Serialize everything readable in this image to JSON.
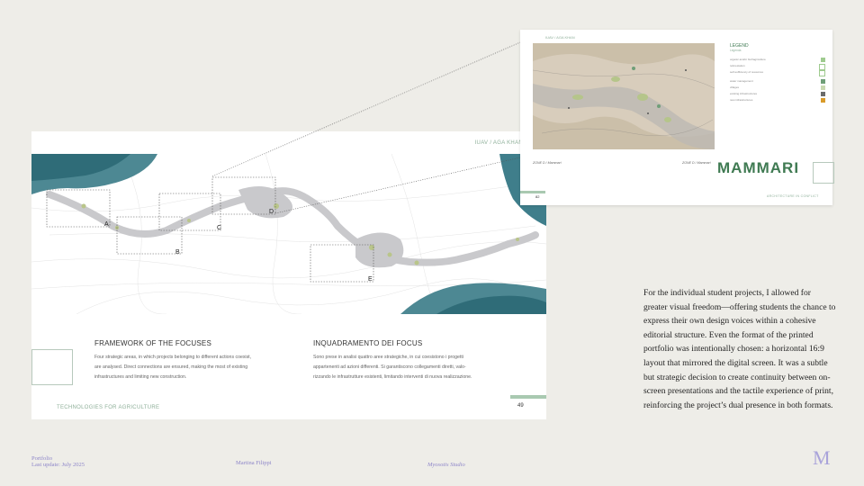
{
  "main_page": {
    "header": "IUAV / AGA KHAN",
    "map_labels": [
      "A",
      "B",
      "C",
      "D",
      "E"
    ],
    "left_section": {
      "title": "FRAMEWORK OF THE FOCUSES",
      "lines": [
        "Four strategic areas, in which projects belonging to different actions coexist,",
        "are analysed. Direct connections are ensured, making the most of existing",
        "infrastructures and limiting new construction."
      ]
    },
    "right_section": {
      "title": "INQUADRAMENTO DEI FOCUS",
      "lines": [
        "Sono prese in analisi quattro aree strategiche, in cui coesistono i progetti",
        "appartenenti ad azioni differenti. Si garantiscono collegamenti diretti, valo-",
        "rizzando le infrastrutture esistenti, limitando interventi di nuova realizzazione."
      ]
    },
    "footer": "TECHNOLOGIES FOR AGRICULTURE",
    "page_number": "49"
  },
  "inset_page": {
    "header": "IUAV / AGA KHAN",
    "legend_title": "LEGEND",
    "legend_subtitle": "Legenda",
    "legend_items": [
      {
        "label": "organic and/or biofragriculture",
        "color": "#9fcb8f"
      },
      {
        "label": "reforestation",
        "color": "#ffffff"
      },
      {
        "label": "self-sufficiency of resources",
        "color": "#ffffff"
      },
      {
        "label": "water management",
        "color": "#6f9e78"
      },
      {
        "label": "villages",
        "color": "#c8d8b0"
      },
      {
        "label": "existing infrastructures",
        "color": "#6b6b6b"
      },
      {
        "label": "new infrastructures",
        "color": "#d99b2a"
      }
    ],
    "zone_left": "ZONE D / Mammari",
    "zone_right": "ZONE D / Mammari",
    "title": "MAMMARI",
    "footer": "ARCHITECTURE IN CONFLICT",
    "page_number": "82"
  },
  "description": "For the individual student projects, I allowed for greater visual freedom—offering students the chance to express their own design voices within a cohesive editorial structure. Even the format of the printed portfolio was intentionally chosen: a horizontal 16:9 layout that mirrored the digital screen. It was a subtle but strategic decision to create continuity between on-screen presentations and the tactile experience of print, reinforcing the project’s dual presence in both formats.",
  "bottom_bar": {
    "portfolio": "Portfolio",
    "last_update": "Last update: July 2025",
    "author": "Martina Filippi",
    "studio": "Myosotis Studio",
    "logo": "M"
  }
}
